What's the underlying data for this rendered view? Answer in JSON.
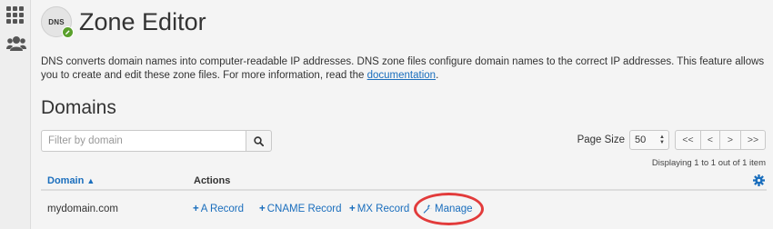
{
  "sidebar": {
    "icons": [
      "apps-grid-icon",
      "users-icon"
    ]
  },
  "header": {
    "badge": "DNS",
    "title": "Zone Editor"
  },
  "description": {
    "text": "DNS converts domain names into computer-readable IP addresses. DNS zone files configure domain names to the correct IP addresses. This feature allows you to create and edit these zone files. For more information, read the ",
    "link": "documentation",
    "suffix": "."
  },
  "section": {
    "title": "Domains"
  },
  "search": {
    "placeholder": "Filter by domain",
    "icon": "search-icon"
  },
  "pagination": {
    "page_size_label": "Page Size",
    "page_size_value": "50",
    "first": "<<",
    "prev": "<",
    "next": ">",
    "last": ">>",
    "displaying": "Displaying 1 to 1 out of 1 item"
  },
  "table": {
    "columns": {
      "domain": "Domain",
      "domain_sort": "▲",
      "actions": "Actions"
    },
    "rows": [
      {
        "domain": "mydomain.com",
        "actions": {
          "a_record": "A Record",
          "cname_record": "CNAME Record",
          "mx_record": "MX Record",
          "manage": "Manage"
        }
      }
    ]
  },
  "colors": {
    "link": "#1a6ebd",
    "highlight": "#e23b3b",
    "badge_pencil": "#5aa02c"
  }
}
